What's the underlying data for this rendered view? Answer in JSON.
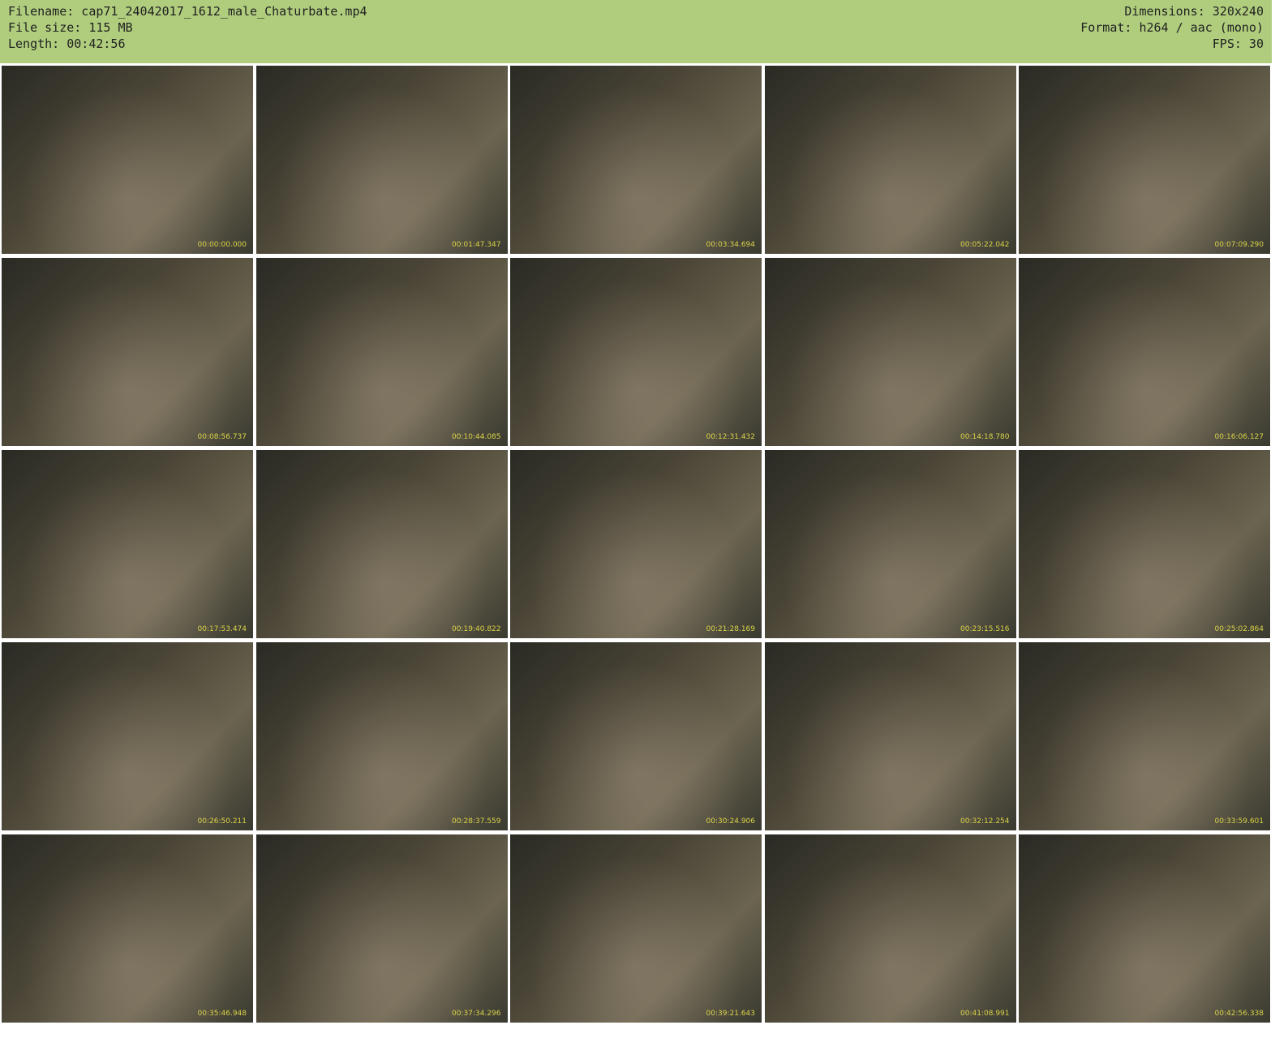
{
  "header": {
    "filename": "Filename: cap71_24042017_1612_male_Chaturbate.mp4",
    "filesize": "File size: 115 MB",
    "length": "Length: 00:42:56",
    "dimensions": "Dimensions: 320x240",
    "format": "Format: h264 / aac (mono)",
    "fps": "FPS: 30"
  },
  "thumbnails": [
    "00:00:00.000",
    "00:01:47.347",
    "00:03:34.694",
    "00:05:22.042",
    "00:07:09.290",
    "00:08:56.737",
    "00:10:44.085",
    "00:12:31.432",
    "00:14:18.780",
    "00:16:06.127",
    "00:17:53.474",
    "00:19:40.822",
    "00:21:28.169",
    "00:23:15.516",
    "00:25:02.864",
    "00:26:50.211",
    "00:28:37.559",
    "00:30:24.906",
    "00:32:12.254",
    "00:33:59.601",
    "00:35:46.948",
    "00:37:34.296",
    "00:39:21.643",
    "00:41:08.991",
    "00:42:56.338"
  ]
}
